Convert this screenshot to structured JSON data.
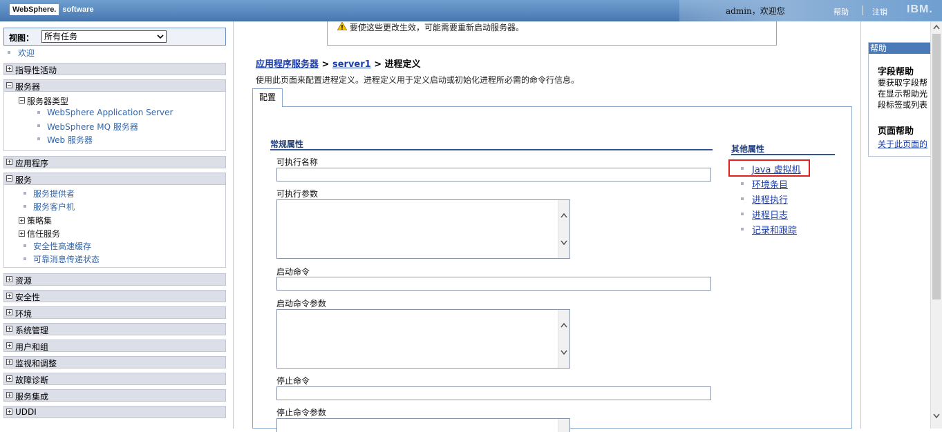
{
  "header": {
    "brand_websphere": "WebSphere.",
    "brand_software": "software",
    "welcome": "admin，欢迎您",
    "help_link": "帮助",
    "logout_link": "注销",
    "ibm_logo": "IBM."
  },
  "sidebar": {
    "view_label": "视图：",
    "view_selected": "所有任务",
    "welcome": "欢迎",
    "groups": {
      "guided": "指导性活动",
      "servers": "服务器",
      "server_types": "服务器类型",
      "was": "WebSphere Application Server",
      "mq": "WebSphere MQ 服务器",
      "web": "Web 服务器",
      "applications": "应用程序",
      "services": "服务",
      "providers": "服务提供者",
      "clients": "服务客户机",
      "policy_sets": "策略集",
      "trust": "信任服务",
      "security_cache": "安全性高速缓存",
      "reliable_msg": "可靠消息传递状态",
      "resources": "资源",
      "security": "安全性",
      "environment": "环境",
      "sysadmin": "系统管理",
      "users_groups": "用户和组",
      "monitoring": "监视和调整",
      "troubleshooting": "故障诊断",
      "integration": "服务集成",
      "uddi": "UDDI"
    }
  },
  "main": {
    "message": "要使这些更改生效，可能需要重新启动服务器。",
    "breadcrumb": {
      "app_servers": "应用程序服务器",
      "sep1": ">",
      "server": "server1",
      "sep2": ">",
      "current": "进程定义"
    },
    "description": "使用此页面来配置进程定义。进程定义用于定义启动或初始化进程所必需的命令行信息。",
    "tab_config": "配置",
    "general_properties": "常规属性",
    "fields": {
      "exec_name": "可执行名称",
      "exec_args": "可执行参数",
      "start_cmd": "启动命令",
      "start_args": "启动命令参数",
      "stop_cmd": "停止命令",
      "stop_args": "停止命令参数"
    },
    "additional_properties": "其他属性",
    "links": {
      "jvm": "Java 虚拟机",
      "env": "环境条目",
      "exec": "进程执行",
      "logs": "进程日志",
      "logging": "记录和跟踪"
    }
  },
  "help": {
    "header": "帮助",
    "field_help_title": "字段帮助",
    "field_help_text1": "要获取字段帮",
    "field_help_text2": "在显示帮助光",
    "field_help_text3": "段标签或列表",
    "page_help_title": "页面帮助",
    "page_help_link": "关于此页面的"
  },
  "colors": {
    "topbar": "#4978b2",
    "link": "#1d3fb0",
    "nav_link": "#3566a8",
    "highlight": "#e02020"
  }
}
